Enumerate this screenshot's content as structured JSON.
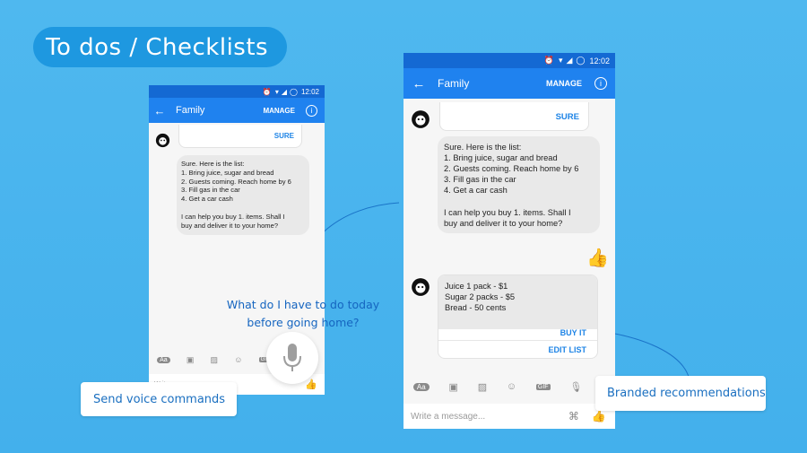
{
  "title": "To dos / Checklists",
  "status": {
    "time": "12:02"
  },
  "app": {
    "chat_title": "Family",
    "manage_label": "MANAGE"
  },
  "conversation": {
    "confirm_button": "SURE",
    "list_message": "Sure. Here is the list:\n1. Bring juice, sugar and bread\n2. Guests coming. Reach home by 6\n3. Fill gas in the car\n4. Get a car cash\n\nI can help you buy 1. items. Shall I\nbuy and deliver it to your home?",
    "recommendation": {
      "text": "Juice 1 pack - $1\nSugar 2 packs - $5\nBread - 50 cents",
      "buy_label": "BUY IT",
      "edit_label": "EDIT LIST"
    }
  },
  "composer": {
    "placeholder": "Write a message...",
    "aa_label": "Aa",
    "gif_label": "GIF"
  },
  "voice_query": "What do I have to do today\nbefore going home?",
  "callouts": {
    "voice": "Send voice commands",
    "branded": "Branded recommendations"
  },
  "colors": {
    "background": "#46b3ee",
    "title_pill": "#1e98e0",
    "status_bar": "#1469d3",
    "app_bar": "#1f82ef",
    "accent": "#1e84e6"
  }
}
